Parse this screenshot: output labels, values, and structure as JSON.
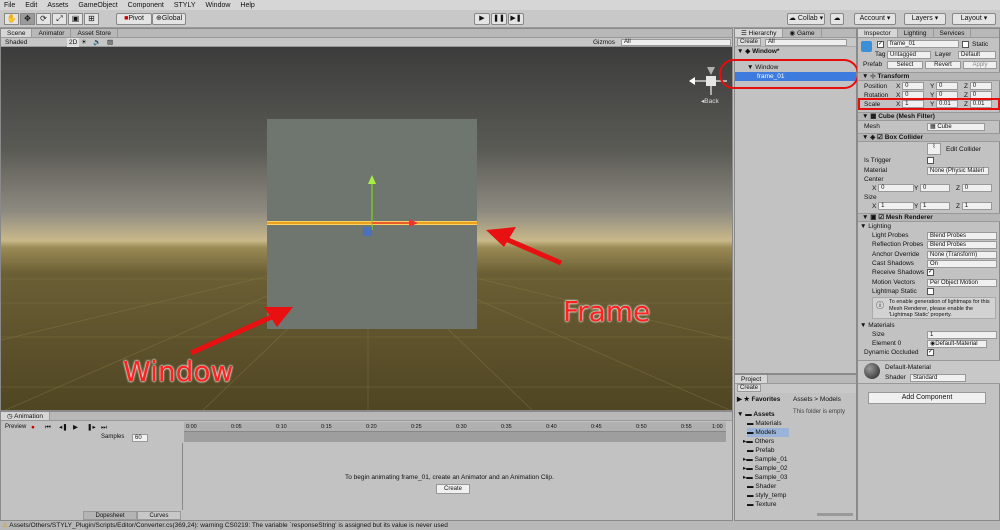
{
  "menu": [
    "File",
    "Edit",
    "Assets",
    "GameObject",
    "Component",
    "STYLY",
    "Window",
    "Help"
  ],
  "toolbar": {
    "pivot": "Pivot",
    "global": "Global",
    "collab": "Collab",
    "account": "Account",
    "layers": "Layers",
    "layout": "Layout"
  },
  "scene": {
    "tabs": [
      "Scene",
      "Animator",
      "Asset Store"
    ],
    "shaded": "Shaded",
    "mode2d": "2D",
    "gizmos": "Gizmos",
    "search": "All",
    "back_label": "Back"
  },
  "annotations": {
    "frame": "Frame",
    "window": "Window"
  },
  "hierarchy": {
    "tab": "Hierarchy",
    "game_tab": "Game",
    "create": "Create",
    "search": "All",
    "scene": "Window*",
    "items": [
      "Window",
      "frame_01"
    ]
  },
  "inspector": {
    "tabs": [
      "Inspector",
      "Lighting",
      "Services"
    ],
    "name": "frame_01",
    "static": "Static",
    "tag_label": "Tag",
    "tag": "Untagged",
    "layer_label": "Layer",
    "layer": "Default",
    "prefab_label": "Prefab",
    "select": "Select",
    "revert": "Revert",
    "apply": "Apply",
    "transform": "Transform",
    "position": "Position",
    "rotation": "Rotation",
    "scale": "Scale",
    "pos": {
      "x": "0",
      "y": "0",
      "z": "0"
    },
    "rot": {
      "x": "0",
      "y": "0",
      "z": "0"
    },
    "scl": {
      "x": "1",
      "y": "0.01",
      "z": "0.01"
    },
    "meshfilter": "Cube (Mesh Filter)",
    "mesh_label": "Mesh",
    "mesh": "Cube",
    "boxcollider": "Box Collider",
    "edit_collider": "Edit Collider",
    "is_trigger": "Is Trigger",
    "material_label": "Material",
    "material": "None (Physic Materi",
    "center": "Center",
    "size": "Size",
    "center_v": {
      "x": "0",
      "y": "0",
      "z": "0"
    },
    "size_v": {
      "x": "1",
      "y": "1",
      "z": "1"
    },
    "meshrenderer": "Mesh Renderer",
    "lighting": "Lighting",
    "light_probes": "Light Probes",
    "light_probes_v": "Blend Probes",
    "refl_probes": "Reflection Probes",
    "refl_probes_v": "Blend Probes",
    "anchor": "Anchor Override",
    "anchor_v": "None (Transform)",
    "cast": "Cast Shadows",
    "cast_v": "On",
    "receive": "Receive Shadows",
    "motion": "Motion Vectors",
    "motion_v": "Per Object Motion",
    "lightmap": "Lightmap Static",
    "info": "To enable generation of lightmaps for this Mesh Renderer, please enable the 'Lightmap Static' property.",
    "materials": "Materials",
    "size_label": "Size",
    "size_val": "1",
    "element0": "Element 0",
    "element0_v": "Default-Material",
    "dyn": "Dynamic Occluded",
    "mat_name": "Default-Material",
    "shader_label": "Shader",
    "shader": "Standard",
    "add_component": "Add Component"
  },
  "project": {
    "tab": "Project",
    "create": "Create",
    "favorites": "Favorites",
    "breadcrumb": "Assets > Models",
    "empty": "This folder is empty",
    "tree": [
      "Assets",
      "Materials",
      "Models",
      "Others",
      "Prefab",
      "Sample_01",
      "Sample_02",
      "Sample_03",
      "Shader",
      "styly_temp",
      "Texture"
    ]
  },
  "animation": {
    "tab": "Animation",
    "preview": "Preview",
    "samples": "Samples",
    "samples_v": "60",
    "ticks": [
      "0:00",
      "0:05",
      "0:10",
      "0:15",
      "0:20",
      "0:25",
      "0:30",
      "0:35",
      "0:40",
      "0:45",
      "0:50",
      "0:55",
      "1:00"
    ],
    "message": "To begin animating frame_01, create an Animator and an Animation Clip.",
    "create": "Create",
    "dopesheet": "Dopesheet",
    "curves": "Curves"
  },
  "status": "Assets/Others/STYLY_Plugin/Scripts/Editor/Converter.cs(369,24): warning CS0219: The variable `responseString' is assigned but its value is never used"
}
